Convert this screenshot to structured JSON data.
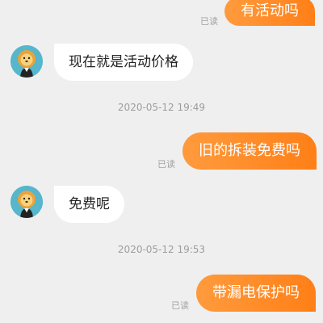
{
  "chat": {
    "messages": [
      {
        "side": "out",
        "text": "有活动吗",
        "read": "已读"
      },
      {
        "side": "in",
        "text": "现在就是活动价格"
      },
      {
        "side": "time",
        "text": "2020-05-12 19:49"
      },
      {
        "side": "out",
        "text": "旧的拆装免费吗",
        "read": "已读"
      },
      {
        "side": "in",
        "text": "免费呢"
      },
      {
        "side": "time",
        "text": "2020-05-12 19:53"
      },
      {
        "side": "out",
        "text": "带漏电保护吗",
        "read": "已读"
      }
    ],
    "colors": {
      "background": "#efefef",
      "outgoing_gradient_start": "#ff9b3d",
      "outgoing_gradient_end": "#ff7f17",
      "incoming_bubble": "#ffffff",
      "avatar_bg": "#55b6cc"
    },
    "avatar_icon": "lion-mascot-icon"
  }
}
